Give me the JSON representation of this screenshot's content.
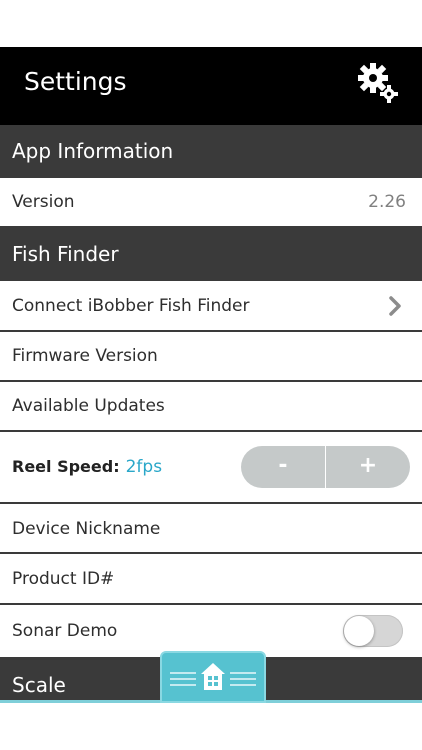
{
  "header": {
    "title": "Settings",
    "icon": "gears-icon"
  },
  "sections": {
    "app_information": {
      "title": "App Information",
      "version_label": "Version",
      "version_value": "2.26"
    },
    "fish_finder": {
      "title": "Fish Finder",
      "connect_label": "Connect iBobber Fish Finder",
      "firmware_label": "Firmware Version",
      "updates_label": "Available Updates",
      "reel_speed_label": "Reel Speed:",
      "reel_speed_value": "2fps",
      "stepper_minus": "-",
      "stepper_plus": "+",
      "nickname_label": "Device Nickname",
      "product_id_label": "Product ID#",
      "sonar_demo_label": "Sonar Demo",
      "sonar_demo_on": false
    },
    "scale": {
      "title": "Scale"
    }
  },
  "bottom_nav": {
    "home_icon": "home-icon"
  },
  "colors": {
    "header_bg": "#000000",
    "section_bg": "#3a3a3a",
    "accent": "#2aa7c9",
    "home_tab": "#56c2d0",
    "stepper_bg": "#c5c9c9"
  }
}
